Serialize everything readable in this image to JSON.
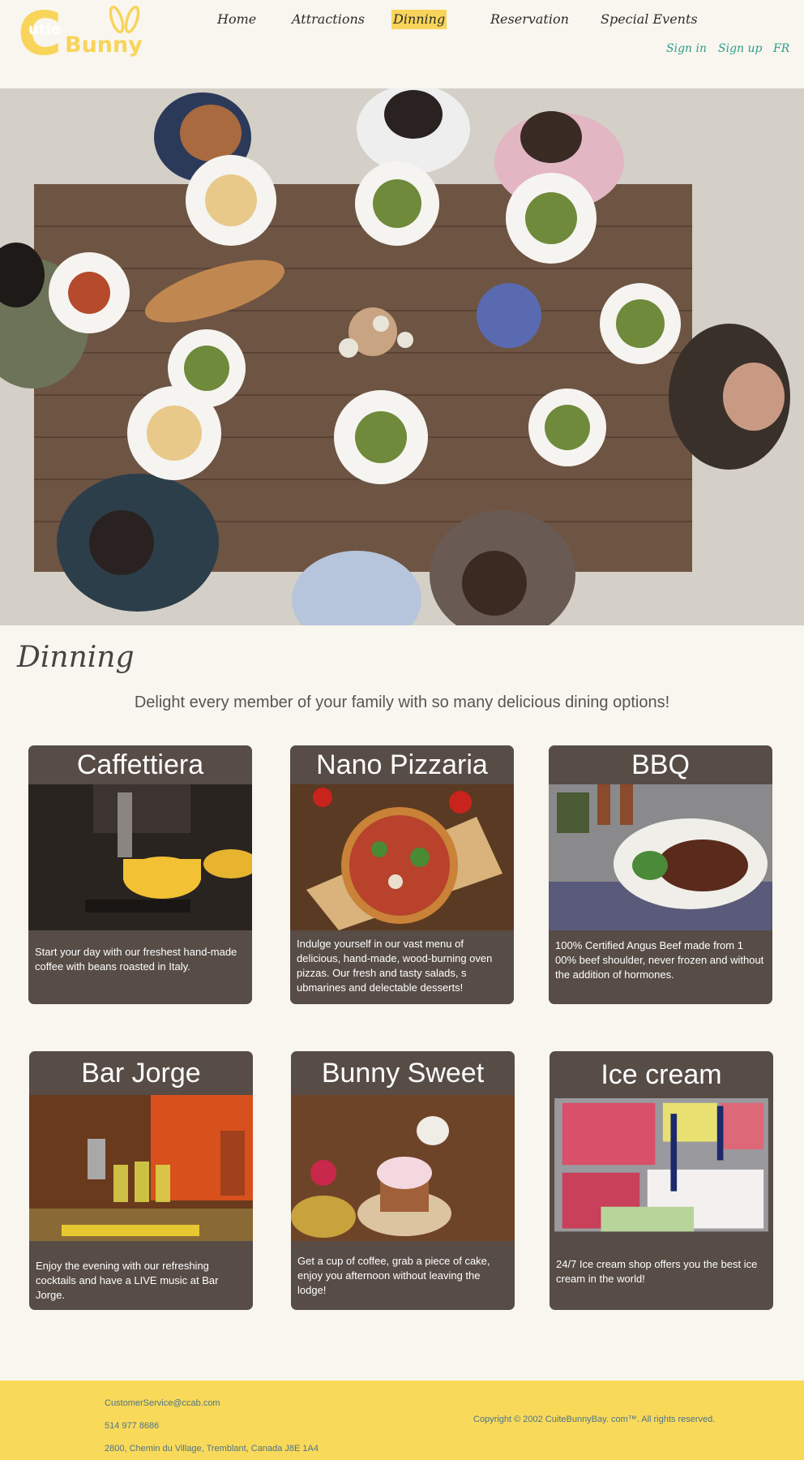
{
  "brand": {
    "logo_letter": "C",
    "logo_small": "utie",
    "logo_large": "Bunny"
  },
  "nav": {
    "items": [
      {
        "label": "Home"
      },
      {
        "label": "Attractions"
      },
      {
        "label": "Dinning"
      },
      {
        "label": "Reservation"
      },
      {
        "label": "Special Events"
      }
    ],
    "active": "Dinning"
  },
  "auth": {
    "sign_in": "Sign in",
    "sign_up": "Sign up",
    "language": "FR"
  },
  "page": {
    "title": "Dinning",
    "tagline": "Delight every member of your family with so many delicious dining options!"
  },
  "cards": [
    {
      "title": "Caffettiera",
      "description": "Start your day with our freshest hand-made coffee with beans roasted in Italy."
    },
    {
      "title": "Nano Pizzaria",
      "description": "Indulge yourself in our vast menu of delicious, hand-made, wood-burning oven pizzas. Our fresh and tasty salads, s ubmarines and delectable desserts!"
    },
    {
      "title": "BBQ",
      "description": "100% Certified Angus Beef made from 1 00% beef shoulder, never frozen and without the addition of hormones."
    },
    {
      "title": "Bar Jorge",
      "description": "Enjoy the evening with our refreshing cocktails and have a LIVE music at Bar Jorge."
    },
    {
      "title": "Bunny Sweet",
      "description": "Get a cup of coffee, grab a piece of cake, enjoy you afternoon without leaving the lodge!"
    },
    {
      "title": "Ice cream",
      "description": "24/7 Ice cream shop offers you the best ice cream in the world!"
    }
  ],
  "footer": {
    "email": "CustomerService@ccab.com",
    "phone": "514 977 8686",
    "address": "2800, Chemin du Village, Tremblant, Canada J8E 1A4",
    "copyright": "Copyright © 2002 CuiteBunnyBay. com™. All rights reserved."
  },
  "colors": {
    "background": "#f9f6ef",
    "brand_yellow": "#f8d45a",
    "card_bg": "#574c46",
    "link_teal": "#2d9d8d",
    "footer_text": "#4e7489"
  }
}
